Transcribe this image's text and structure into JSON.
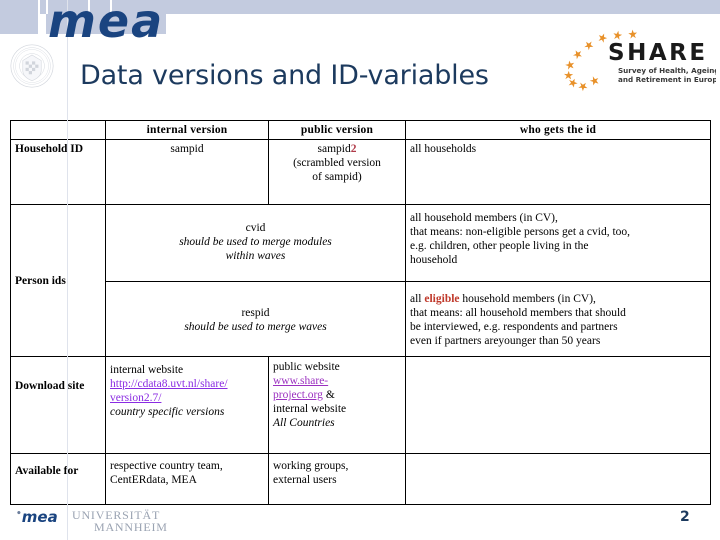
{
  "slide": {
    "title": "Data versions and ID-variables",
    "page_number": "2",
    "brand_logo": "mea",
    "footer_logo": "mea",
    "footer_university_line1": "UNIVERSITÄT",
    "footer_university_line2": "MANNHEIM",
    "share_logo_word": "SHARE",
    "share_logo_tagline_line1": "Survey of Health, Ageing",
    "share_logo_tagline_line2": "and Retirement in Europe"
  },
  "colors": {
    "title": "#1c3a5e",
    "brand_blue": "#1a4480",
    "band": "#c3cbdf",
    "accent_red": "#b03a48",
    "highlight_red": "#c0392b",
    "link_purple": "#8a2be2",
    "star_orange": "#e8912a"
  },
  "table": {
    "headers": {
      "blank": "",
      "internal_version": "internal version",
      "public_version": "public version",
      "who_gets_the_id": "who gets the id"
    },
    "rows": {
      "household_id": {
        "label": "Household ID",
        "internal_version": "sampid",
        "public_version_main": "sampid",
        "public_version_superscript": "2",
        "public_version_note_line1": "(scrambled version",
        "public_version_note_line2": "of sampid)",
        "who_gets_the_id": "all households"
      },
      "person_ids": {
        "label": "Person ids",
        "cvid": {
          "id_name": "cvid",
          "note_line1": "should be used to merge modules",
          "note_line2": "within waves",
          "who_line1": "all household members (in CV),",
          "who_line2": "that means: non-eligible persons get a cvid, too,",
          "who_line3": "e.g. children, other people living in the",
          "who_line4": "household"
        },
        "respid": {
          "id_name": "respid",
          "note_line1": "should be used to merge waves",
          "who_prefix": "all ",
          "who_highlight": "eligible",
          "who_suffix": " household members (in CV),",
          "who_line2": "that means: all household members that should",
          "who_line3": "be interviewed, e.g. respondents and partners",
          "who_line4": "even if partners areyounger than 50 years"
        }
      },
      "download_site": {
        "label": "Download site",
        "internal_label": "internal website",
        "internal_url_line1": "http://cdata8.uvt.nl/share/",
        "internal_url_line2": "version2.7/",
        "internal_note": "country specific versions",
        "public_label": "public website",
        "public_url_line1": "www.share-",
        "public_url_line2": "project.org",
        "public_ampersand": " &",
        "public_note_label": "internal website",
        "public_note_italic": "All Countries",
        "who_gets_the_id": ""
      },
      "available_for": {
        "label": "Available for",
        "internal_line1": "respective country team,",
        "internal_line2": "CentERdata, MEA",
        "public_line1": "working groups,",
        "public_line2": "external users",
        "who_gets_the_id": ""
      }
    }
  }
}
